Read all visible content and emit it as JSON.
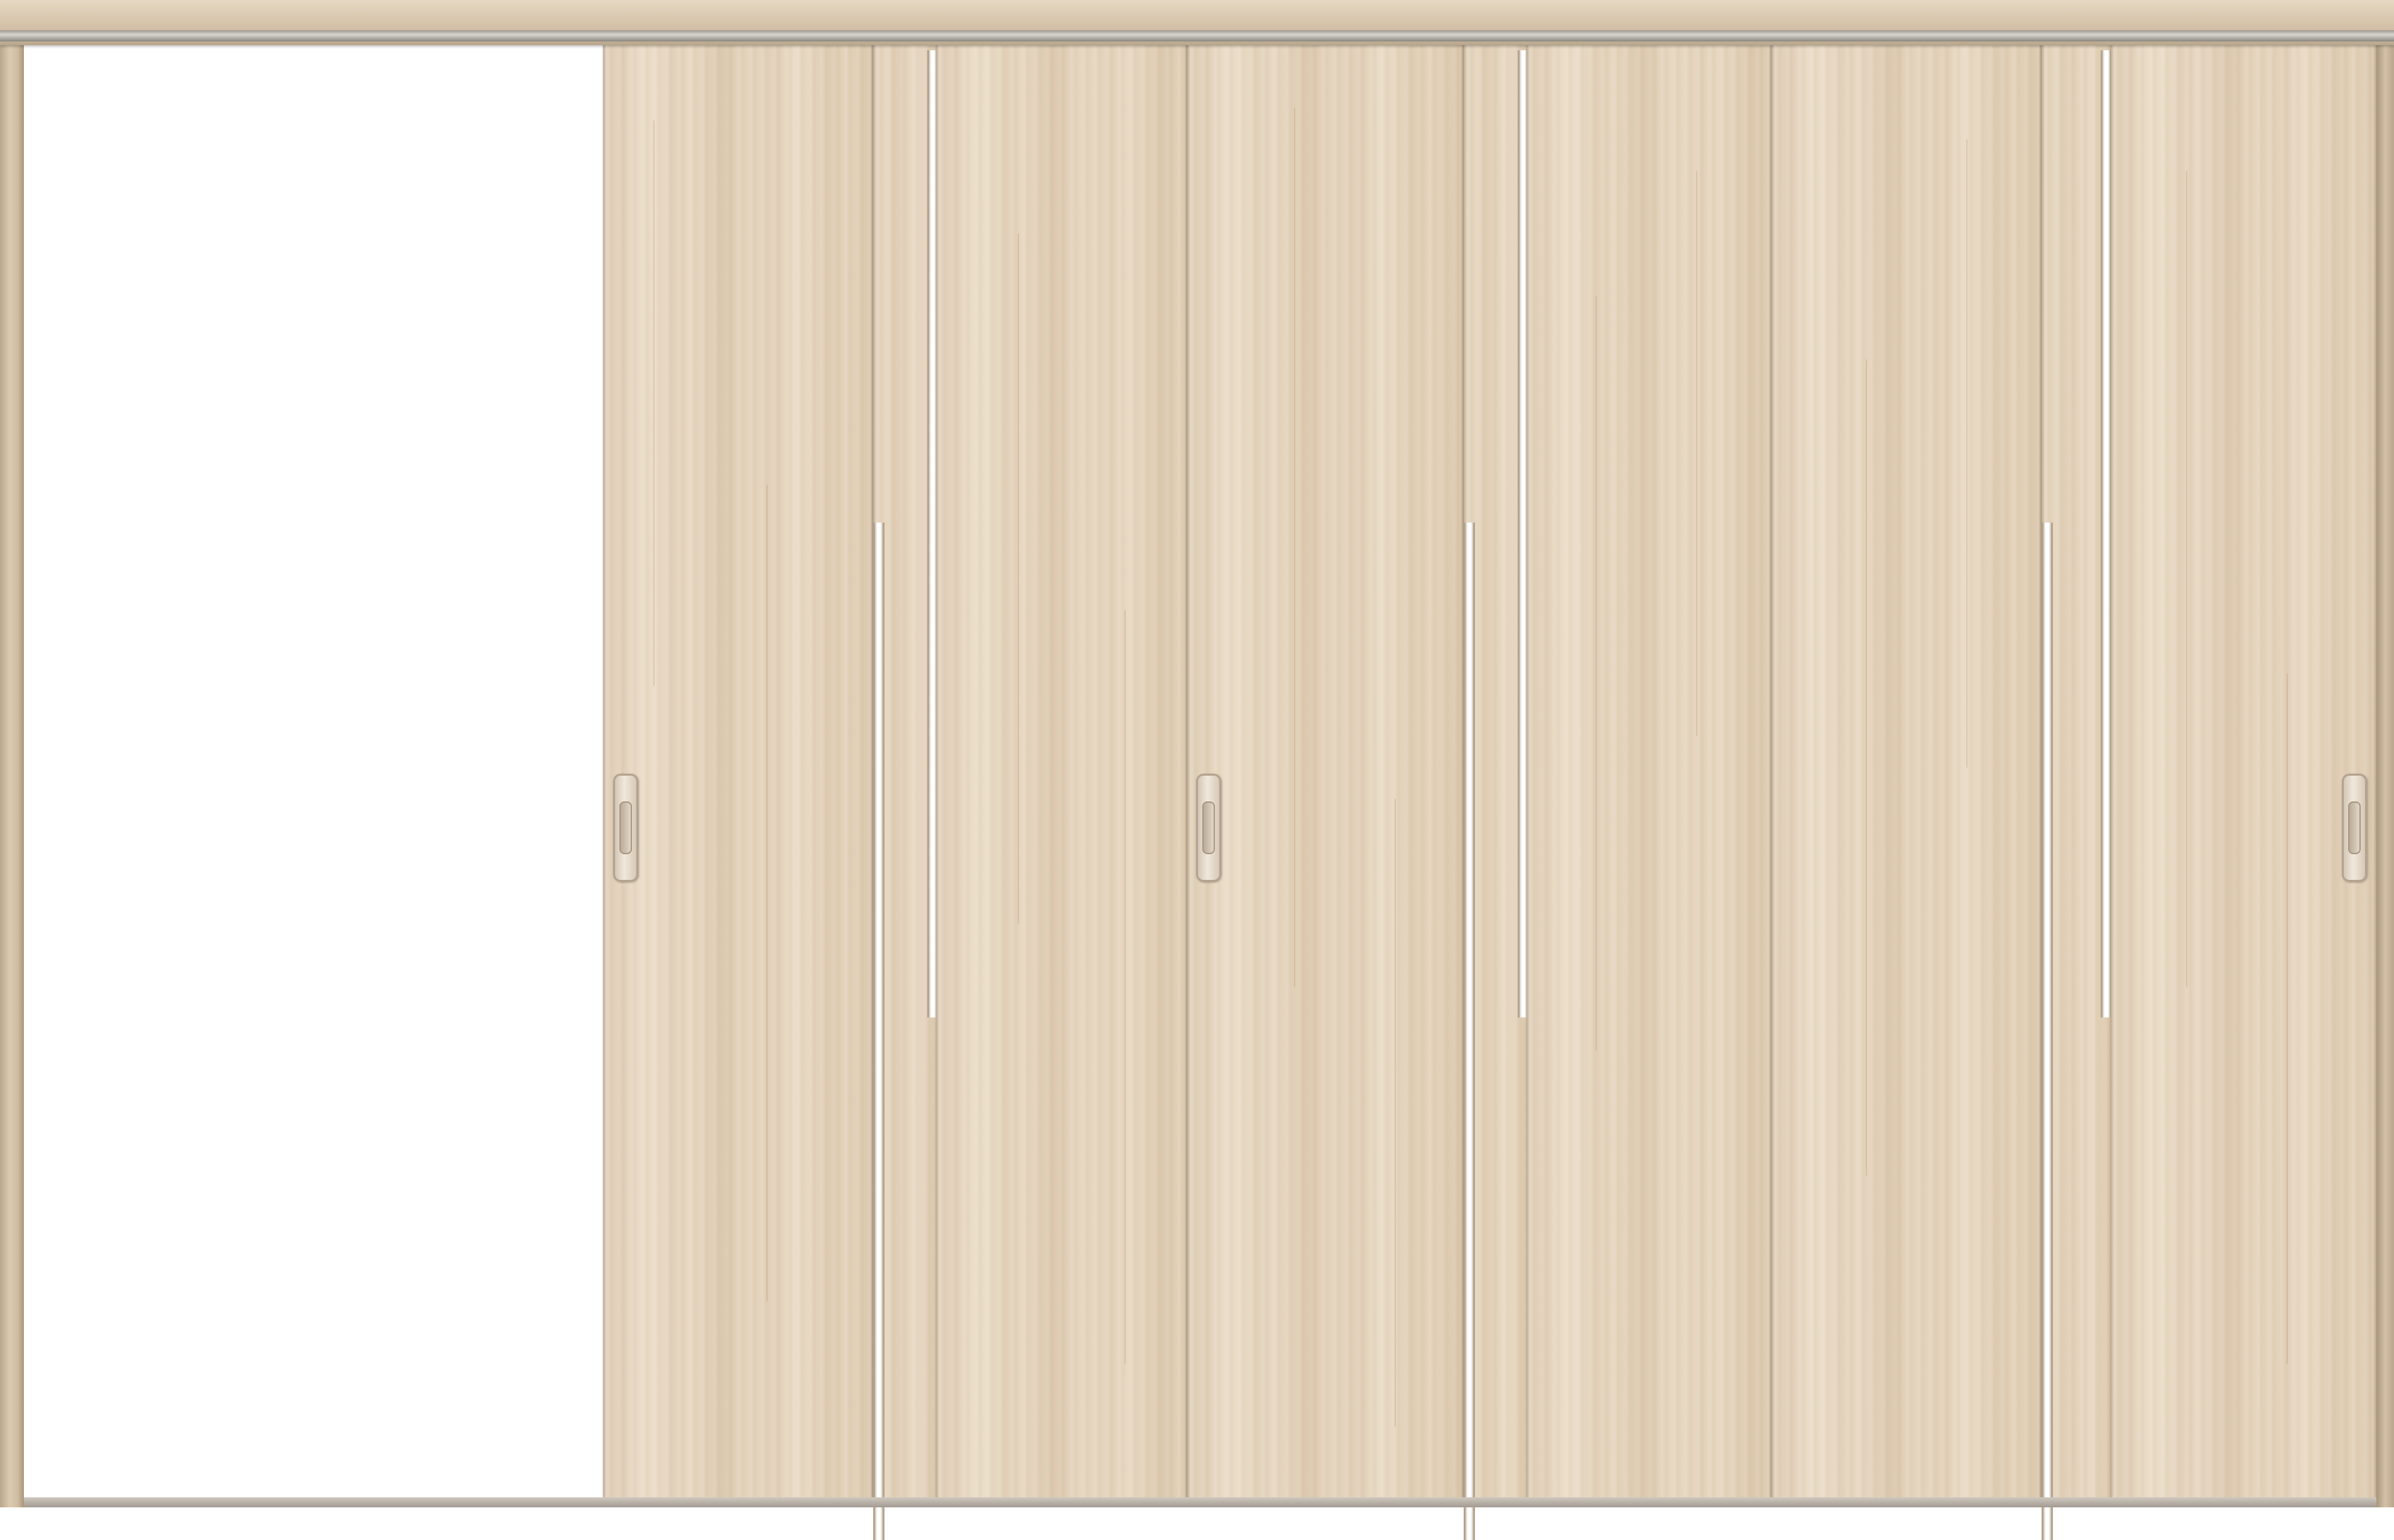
{
  "image": {
    "subject": "",
    "material_color": "#e3d3bd",
    "frame_color": "#d8c6ad",
    "opening_color": "#ffffff",
    "glass_slit_color": "#ffffff",
    "handle_icon": "recessed-pull-handle"
  }
}
